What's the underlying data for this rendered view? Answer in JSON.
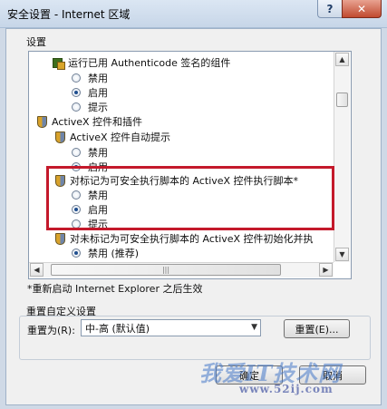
{
  "window": {
    "title": "安全设置 - Internet 区域",
    "help_glyph": "?",
    "close_glyph": "✕"
  },
  "settings": {
    "group_label": "设置",
    "items": [
      {
        "kind": "sub",
        "icon": "certificate-icon",
        "label": "运行已用 Authenticode 签名的组件"
      },
      {
        "kind": "radio",
        "label": "禁用",
        "checked": false
      },
      {
        "kind": "radio",
        "label": "启用",
        "checked": true
      },
      {
        "kind": "radio",
        "label": "提示",
        "checked": false
      },
      {
        "kind": "header",
        "icon": "shield-icon",
        "label": "ActiveX 控件和插件"
      },
      {
        "kind": "sub",
        "icon": "shield-icon",
        "label": "ActiveX 控件自动提示"
      },
      {
        "kind": "radio",
        "label": "禁用",
        "checked": false
      },
      {
        "kind": "radio",
        "label": "启用",
        "checked": true
      },
      {
        "kind": "sub",
        "icon": "shield-icon",
        "label": "对标记为可安全执行脚本的 ActiveX 控件执行脚本*"
      },
      {
        "kind": "radio",
        "label": "禁用",
        "checked": false
      },
      {
        "kind": "radio",
        "label": "启用",
        "checked": true
      },
      {
        "kind": "radio",
        "label": "提示",
        "checked": false
      },
      {
        "kind": "sub",
        "icon": "shield-icon",
        "label": "对未标记为可安全执行脚本的 ActiveX 控件初始化并执"
      },
      {
        "kind": "radio",
        "label": "禁用 (推荐)",
        "checked": true
      }
    ]
  },
  "note": "*重新启动 Internet Explorer 之后生效",
  "reset": {
    "group_label": "重置自定义设置",
    "field_label": "重置为(R):",
    "selected": "中-高 (默认值)",
    "button": "重置(E)..."
  },
  "buttons": {
    "ok": "确定",
    "cancel": "取消"
  },
  "watermark": {
    "main": "我爱IT技术网",
    "sub": "www.52ij.com"
  },
  "scroll": {
    "vertical_up": "▲",
    "vertical_down": "▼",
    "horizontal_left": "◀",
    "horizontal_right": "▶",
    "grip": "|||"
  }
}
